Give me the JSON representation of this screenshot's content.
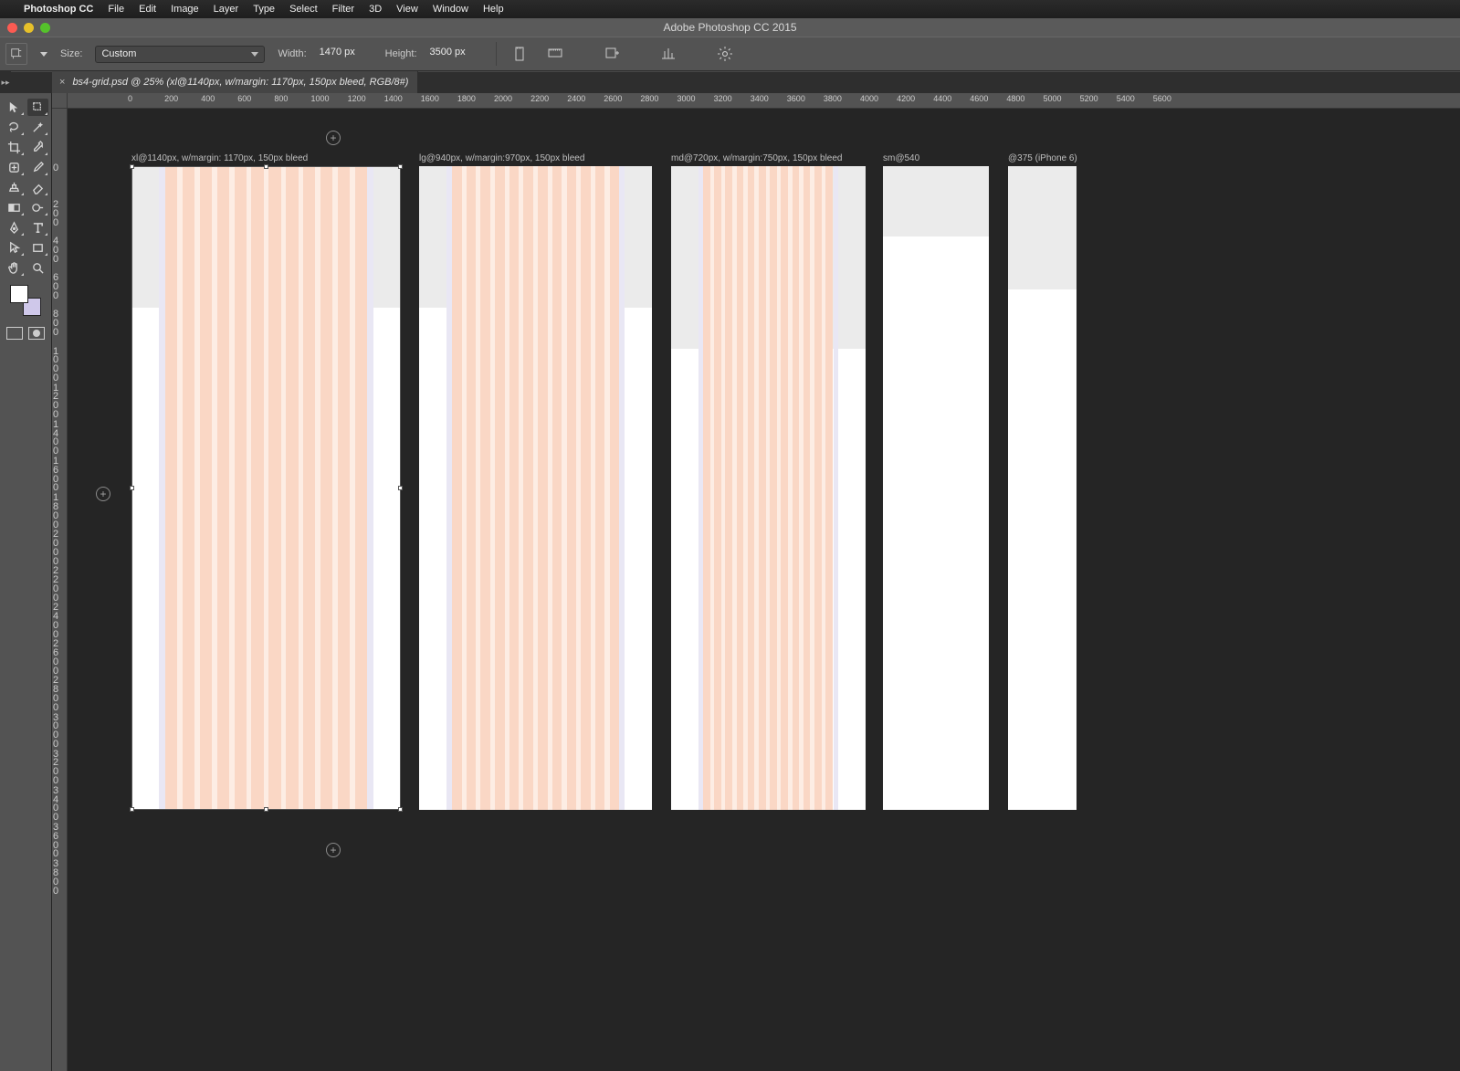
{
  "menubar": {
    "app": "Photoshop CC",
    "items": [
      "File",
      "Edit",
      "Image",
      "Layer",
      "Type",
      "Select",
      "Filter",
      "3D",
      "View",
      "Window",
      "Help"
    ]
  },
  "window_title": "Adobe Photoshop CC 2015",
  "options": {
    "size_label": "Size:",
    "size_value": "Custom",
    "width_label": "Width:",
    "width_value": "1470 px",
    "height_label": "Height:",
    "height_value": "3500 px"
  },
  "tab": {
    "close": "×",
    "title": "bs4-grid.psd @ 25% (xl@1140px, w/margin: 1170px, 150px bleed, RGB/8#)"
  },
  "hruler": [
    "0",
    "200",
    "400",
    "600",
    "800",
    "1000",
    "1200",
    "1400",
    "1600",
    "1800",
    "2000",
    "2200",
    "2400",
    "2600",
    "2800",
    "3000",
    "3200",
    "3400",
    "3600",
    "3800",
    "4000",
    "4200",
    "4400",
    "4600",
    "4800",
    "5000",
    "5200",
    "5400",
    "5600"
  ],
  "vruler": [
    "0",
    "200",
    "400",
    "600",
    "800",
    "1000",
    "1200",
    "1400",
    "1600",
    "1800",
    "2000",
    "2200",
    "2400",
    "2600",
    "2800",
    "3000",
    "3200",
    "3400",
    "3600",
    "3800"
  ],
  "artboards": {
    "xl": {
      "label": "xl@1140px, w/margin: 1170px, 150px bleed"
    },
    "lg": {
      "label": "lg@940px, w/margin:970px, 150px bleed"
    },
    "md": {
      "label": "md@720px, w/margin:750px, 150px bleed"
    },
    "sm": {
      "label": "sm@540"
    },
    "xs": {
      "label": "@375 (iPhone 6)"
    }
  },
  "colors": {
    "fg": "#ffffff",
    "bg": "#cfc8ea",
    "col": "#fad7c5",
    "gutter": "#fdede4",
    "margin": "#e9e7f4",
    "grey": "#ebebeb"
  },
  "tools": [
    [
      "move-tool",
      "artboard-tool"
    ],
    [
      "lasso-tool",
      "magic-wand-tool"
    ],
    [
      "crop-tool",
      "eyedropper-tool"
    ],
    [
      "healing-brush-tool",
      "brush-tool"
    ],
    [
      "clone-stamp-tool",
      "eraser-tool"
    ],
    [
      "gradient-tool",
      "dodge-tool"
    ],
    [
      "pen-tool",
      "type-tool"
    ],
    [
      "path-select-tool",
      "rectangle-tool"
    ],
    [
      "hand-tool",
      "zoom-tool"
    ]
  ]
}
